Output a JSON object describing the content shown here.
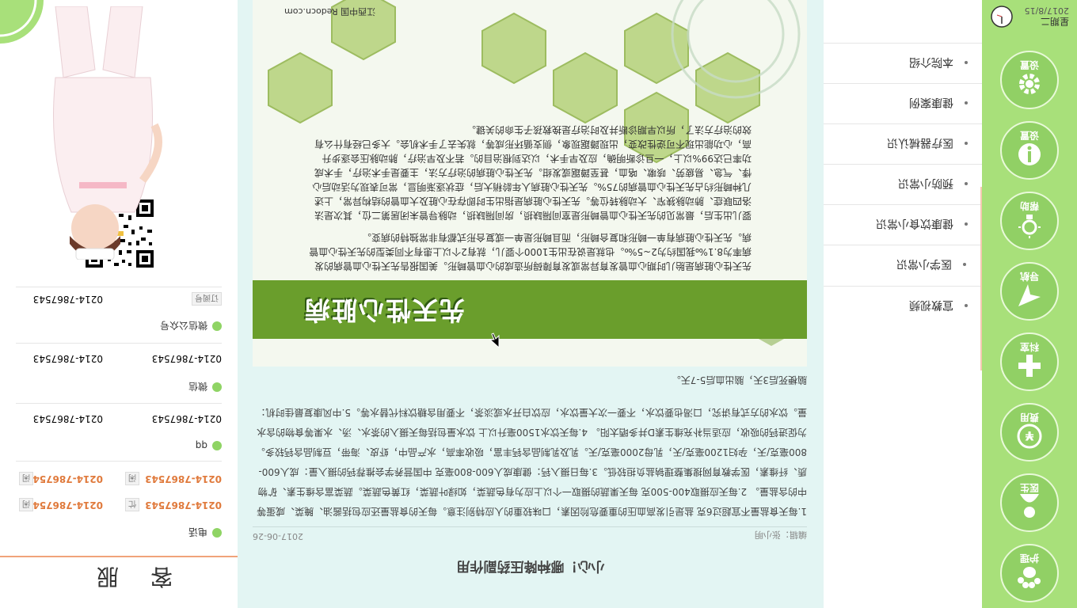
{
  "nav": {
    "items": [
      {
        "label": "护理"
      },
      {
        "label": "医生"
      },
      {
        "label": "费用"
      },
      {
        "label": "科室"
      },
      {
        "label": "导航"
      },
      {
        "label": "帮助"
      },
      {
        "label": "设置"
      }
    ],
    "clock": {
      "day_of_week": "星期二",
      "date": "2017/8/15"
    }
  },
  "menu": {
    "items": [
      {
        "label": "宣教视频"
      },
      {
        "label": "医学小常识"
      },
      {
        "label": "健康饮食小常识"
      },
      {
        "label": "预防小常识"
      },
      {
        "label": "医疗器械认识"
      },
      {
        "label": "健康案例"
      },
      {
        "label": "本院介绍"
      }
    ]
  },
  "article": {
    "title": "小心！哪种降压药副作用",
    "editor": "编辑：张小明",
    "date": "2017-06-26",
    "para1": "1.每天食盐量不宜超过6克 盐是引发高血压的重要危险因素，口味较重的人应特别注意。每天的食盐量还应包括酱油、腌菜、咸蛋等中的含盐量。 2.每天应摄取400-500克 每天果蔬的摄取一个以上应为有色蔬菜，如绿叶蔬菜，红黄色蔬菜。蔬菜富含维生素、矿物质、纤维素，医学教育网搜集整理钠盐负担较低。3.每日摄入钙：健康成人600-800毫克 中国营养学会推荐钙的摄入量：成人600-800毫克/天，孕妇1200毫克/天，乳母2000毫克/天。乳及乳制品含钙丰富，吸收率高，水产品中，虾皮、海带，豆制品含钙较多。为促进钙的吸收，应适当补充维生素D并多晒太阳。 4.每天饮水1500毫升以上 饮水量包括每天摄入的茶水、汤、水果等食物的含水量。饮水的方式有讲究，口渴也要饮水，不要一次大量饮水，应饮白开水或淡茶，不要用含糖饮料代替水等。5.中风康复最佳时机：",
    "para2": "脑梗死后3天，脑出血后5-7天。",
    "banner": {
      "title": "先天性心脏病",
      "para1": "先天性心脏病是胎儿时期心血管发育异常或发育障碍所造成的心血管畸形。美国报告先天性心血管病的发病率为8.1‰我国约为2~5‰。也就是说在出生1000个婴儿，就有2个以上患有不同类型的先天性心血管病。先天性心脏病有单一畸形和复合畸形，而且畸形是单一或复合形式都有非常独特的病变。",
      "para2": "婴儿出生后，最常见的先天性心血管畸形是室间隔缺损，房间隔缺损，动脉导管未闭居第二位，其次是法洛四联症、肺动脉狭窄、大动脉转位等。先天性心脏病是指出生时即存在心脏及大血管的结构异常，上述几种畸形约占先天性心血管病的75%。先天性心脏病人年龄稍大后，症状逐渐明显，常可表现为活动后心悸、气急、易疲劳、咳嗽、咯血，甚至蹲踞或发绀。先天性心脏病的治疗方法，主要是手术治疗，手术成功率已达99%以上，一旦诊断明确，应及早手术，以达到根治目的。若不及早治疗，肺动脉压会逐步升高，心功能出现不可逆性改变，出现蹲踞现象，侧支循环形成等，就失去了手术机会。大多已经有什么有效的治疗方法了，所以早期诊断并及时治疗是挽救孩子生命的关键。",
      "credit": "江西中国 Redocn.com"
    }
  },
  "service": {
    "title": "客服",
    "phone_label": "电话",
    "qq_label": "qq",
    "wechat_label": "微信",
    "wechat_public_label": "微信公众号",
    "phone_rows": [
      {
        "left": "0214-7867543",
        "left_tag": "忙",
        "right": "0214-7867543",
        "right_tag": "闲"
      },
      {
        "left": "0214-7867543",
        "left_tag": "闲",
        "right": "0214-7867543",
        "right_tag": "闲"
      }
    ],
    "qq_row": {
      "left": "0214-7867543",
      "right": "0214-7867543"
    },
    "wechat_row": {
      "left": "0214-7867543",
      "right": "0214-7867543"
    },
    "public_row": {
      "left": "0214-7867543",
      "tag": "订阅号"
    }
  },
  "colors": {
    "nav": "#a8e07a",
    "accent": "#e07a3c",
    "content_bg": "#e3f5f3",
    "banner_green": "#6a9e2c"
  }
}
